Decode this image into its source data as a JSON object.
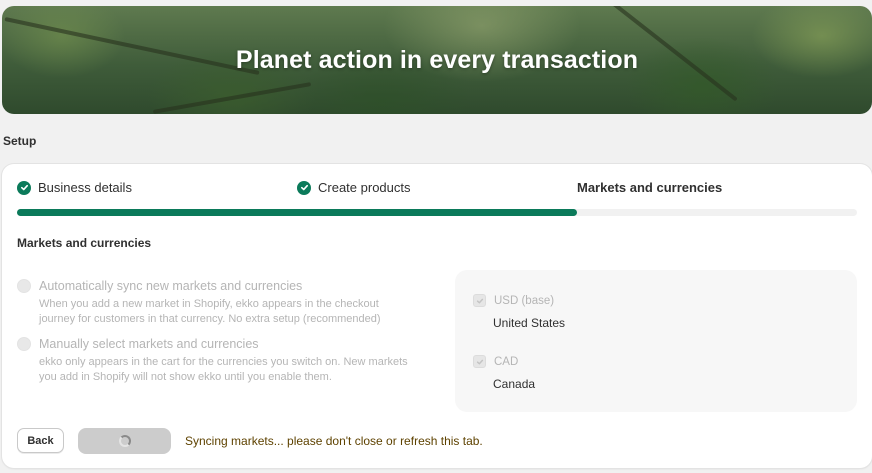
{
  "hero": {
    "title": "Planet action in every transaction"
  },
  "setup": {
    "label": "Setup"
  },
  "steps": [
    {
      "label": "Business details",
      "completed": true
    },
    {
      "label": "Create products",
      "completed": true
    },
    {
      "label": "Markets and currencies",
      "completed": false,
      "active": true
    }
  ],
  "progress": {
    "fraction": 0.667,
    "fill_color": "#0b7a5a"
  },
  "section": {
    "title": "Markets and currencies"
  },
  "options": [
    {
      "title": "Automatically sync new markets and currencies",
      "description": "When you add a new market in Shopify, ekko appears in the checkout journey for customers in that currency. No extra setup (recommended)"
    },
    {
      "title": "Manually select markets and currencies",
      "description": "ekko only appears in the cart for the currencies you switch on. New markets you add in Shopify will not show ekko until you enable them."
    }
  ],
  "currencies": [
    {
      "code": "USD (base)",
      "country": "United States",
      "checked": true
    },
    {
      "code": "CAD",
      "country": "Canada",
      "checked": true
    }
  ],
  "footer": {
    "back_label": "Back",
    "status_message": "Syncing markets... please don't close or refresh this tab."
  },
  "colors": {
    "accent": "#0b7a5a",
    "warning_text": "#5e4200"
  }
}
